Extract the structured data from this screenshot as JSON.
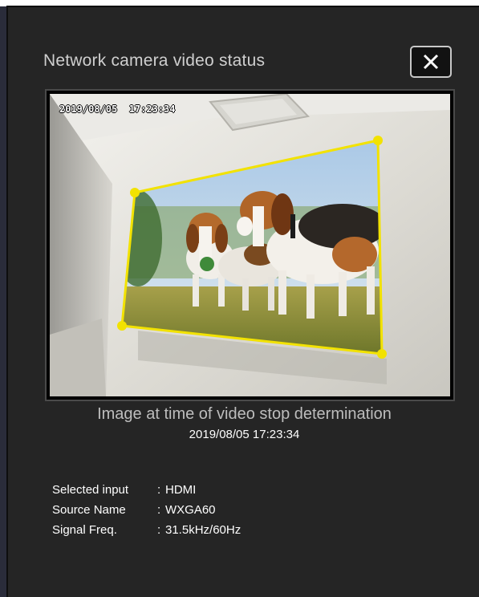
{
  "dialog": {
    "title": "Network camera video status",
    "close_label": "close"
  },
  "camera": {
    "overlay_timestamp": "2019/08/05  17:23:34"
  },
  "caption": {
    "text": "Image at time of video stop determination",
    "timestamp": "2019/08/05 17:23:34"
  },
  "info": [
    {
      "label": "Selected input",
      "sep": ":",
      "value": "HDMI"
    },
    {
      "label": "Source Name",
      "sep": ":",
      "value": "WXGA60"
    },
    {
      "label": "Signal Freq.",
      "sep": ":",
      "value": "31.5kHz/60Hz"
    }
  ],
  "colors": {
    "dialog_bg": "#252525",
    "correction_outline": "#f2e200"
  }
}
